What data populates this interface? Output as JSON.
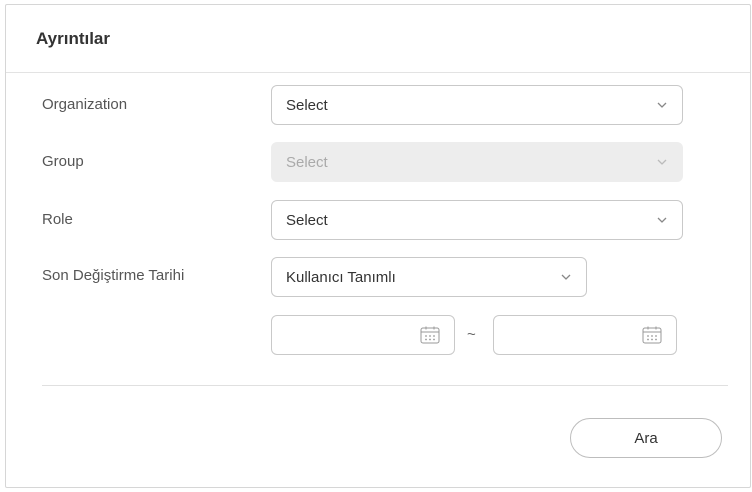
{
  "dialog": {
    "title": "Ayrıntılar"
  },
  "fields": {
    "organization": {
      "label": "Organization",
      "value": "Select"
    },
    "group": {
      "label": "Group",
      "value": "Select",
      "disabled": true
    },
    "role": {
      "label": "Role",
      "value": "Select"
    },
    "last_modified": {
      "label": "Son Değiştirme Tarihi",
      "range_value": "Kullanıcı Tanımlı",
      "start_date": "",
      "end_date": "",
      "separator": "~"
    }
  },
  "actions": {
    "search_label": "Ara"
  },
  "icons": {
    "dropdown": "chevron-down-icon",
    "date": "calendar-icon"
  }
}
